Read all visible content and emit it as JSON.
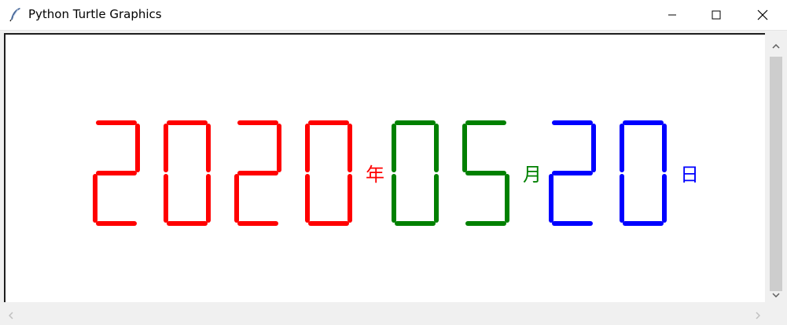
{
  "window": {
    "title": "Python Turtle Graphics",
    "icon": "feather-icon"
  },
  "controls": [
    "minimize-icon",
    "maximize-icon",
    "close-icon"
  ],
  "display": {
    "groups": [
      {
        "digits": "2020",
        "unit": "年",
        "color": "#ff0000"
      },
      {
        "digits": "05",
        "unit": "月",
        "color": "#008000"
      },
      {
        "digits": "20",
        "unit": "日",
        "color": "#0000ff"
      }
    ]
  },
  "scrollbars": {
    "icons": [
      "chevron-up-icon",
      "chevron-down-icon",
      "chevron-left-icon",
      "chevron-right-icon"
    ]
  }
}
